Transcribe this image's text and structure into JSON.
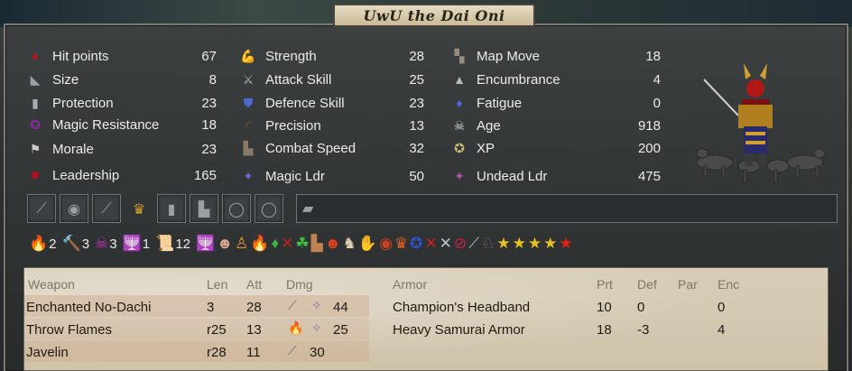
{
  "title": "UwU the Dai Oni",
  "stats": {
    "col1": [
      {
        "icon": "blood-drop-icon",
        "glyph": "♦",
        "color": "#c0101a",
        "label": "Hit points",
        "value": "67"
      },
      {
        "icon": "size-icon",
        "glyph": "◣",
        "color": "#9aa0a4",
        "label": "Size",
        "value": "8"
      },
      {
        "icon": "armor-icon",
        "glyph": "▮",
        "color": "#a9adb0",
        "label": "Protection",
        "value": "23"
      },
      {
        "icon": "pentagram-icon",
        "glyph": "✪",
        "color": "#8a2aa0",
        "label": "Magic Resistance",
        "value": "18"
      },
      {
        "icon": "flag-icon",
        "glyph": "⚑",
        "color": "#c9c9c9",
        "label": "Morale",
        "value": "23"
      },
      {
        "icon": "leadership-star-icon",
        "glyph": "✸",
        "color": "#b0101a",
        "label": "Leadership",
        "value": "165"
      }
    ],
    "col2": [
      {
        "icon": "flexed-arm-icon",
        "glyph": "💪",
        "color": "#c87a3a",
        "label": "Strength",
        "value": "28"
      },
      {
        "icon": "sword-icon",
        "glyph": "⚔",
        "color": "#b5b8ba",
        "label": "Attack Skill",
        "value": "25"
      },
      {
        "icon": "shield-icon",
        "glyph": "⛊",
        "color": "#4a6ad0",
        "label": "Defence Skill",
        "value": "23"
      },
      {
        "icon": "bow-icon",
        "glyph": "◜",
        "color": "#8a5a30",
        "label": "Precision",
        "value": "13"
      },
      {
        "icon": "boots-icon",
        "glyph": "▙",
        "color": "#8a7a6a",
        "label": "Combat Speed",
        "value": "32"
      },
      {
        "icon": "magic-leader-icon",
        "glyph": "✦",
        "color": "#6a6ad8",
        "label": "Magic Ldr",
        "value": "50"
      }
    ],
    "col3": [
      {
        "icon": "map-boot-icon",
        "glyph": "▚",
        "color": "#9a8a7a",
        "label": "Map Move",
        "value": "18"
      },
      {
        "icon": "weight-icon",
        "glyph": "▲",
        "color": "#b8b8b8",
        "label": "Encumbrance",
        "value": "4"
      },
      {
        "icon": "fatigue-drop-icon",
        "glyph": "♦",
        "color": "#4a6ae0",
        "label": "Fatigue",
        "value": "0"
      },
      {
        "icon": "skull-icon",
        "glyph": "☠",
        "color": "#d8d8d8",
        "label": "Age",
        "value": "918"
      },
      {
        "icon": "xp-star-icon",
        "glyph": "✪",
        "color": "#c8c070",
        "label": "XP",
        "value": "200"
      },
      {
        "icon": "undead-leader-icon",
        "glyph": "✦",
        "color": "#b050b0",
        "label": "Undead Ldr",
        "value": "475"
      }
    ]
  },
  "slots": [
    {
      "icon": "weapon-slot-icon",
      "glyph": "⟋"
    },
    {
      "icon": "shield-slot-icon",
      "glyph": "◉"
    },
    {
      "icon": "bow-slot-icon",
      "glyph": "⟋"
    },
    {
      "icon": "crown-icon",
      "glyph": "♛"
    },
    {
      "icon": "body-armor-slot-icon",
      "glyph": "▮"
    },
    {
      "icon": "boots-slot-icon",
      "glyph": "▙"
    },
    {
      "icon": "ring-slot-icon",
      "glyph": "◯"
    },
    {
      "icon": "ring-slot-icon-2",
      "glyph": "◯"
    },
    {
      "icon": "misc-slot-icon",
      "glyph": "▰"
    }
  ],
  "effects": [
    {
      "icon": "fire-magic-icon",
      "glyph": "🔥",
      "color": "#f07020",
      "count": "2"
    },
    {
      "icon": "hammer-icon",
      "glyph": "🔨",
      "color": "#c08040",
      "count": "3"
    },
    {
      "icon": "death-magic-skull-icon",
      "glyph": "☠",
      "color": "#c030c0",
      "count": "3"
    },
    {
      "icon": "candelabra-icon",
      "glyph": "🕎",
      "color": "#e0c070",
      "count": "1"
    },
    {
      "icon": "scroll-icon",
      "glyph": "📜",
      "color": "#d0a060",
      "count": "12"
    },
    {
      "icon": "candelabra-icon-2",
      "glyph": "🕎",
      "color": "#e0c070",
      "count": ""
    },
    {
      "icon": "head-icon",
      "glyph": "☻",
      "color": "#d8a890",
      "count": ""
    },
    {
      "icon": "idol-icon",
      "glyph": "♙",
      "color": "#e09030",
      "count": ""
    },
    {
      "icon": "flame-icon",
      "glyph": "🔥",
      "color": "#f05010",
      "count": ""
    },
    {
      "icon": "poison-drop-icon",
      "glyph": "♦",
      "color": "#40b040",
      "count": ""
    },
    {
      "icon": "no-weapon-icon",
      "glyph": "✕",
      "color": "#c02020",
      "count": ""
    },
    {
      "icon": "clover-icon",
      "glyph": "☘",
      "color": "#40c040",
      "count": ""
    },
    {
      "icon": "boot-icon",
      "glyph": "▙",
      "color": "#c08050",
      "count": ""
    },
    {
      "icon": "demon-head-icon",
      "glyph": "☻",
      "color": "#e04020",
      "count": ""
    },
    {
      "icon": "goat-icon",
      "glyph": "♞",
      "color": "#e0d0b0",
      "count": ""
    },
    {
      "icon": "hand-icon",
      "glyph": "✋",
      "color": "#e08050",
      "count": ""
    },
    {
      "icon": "eye-icon",
      "glyph": "◉",
      "color": "#d04020",
      "count": ""
    },
    {
      "icon": "crown-fire-icon",
      "glyph": "♛",
      "color": "#e06020",
      "count": ""
    },
    {
      "icon": "blue-pentagram-icon",
      "glyph": "✪",
      "color": "#3050d0",
      "count": ""
    },
    {
      "icon": "crossed-swords-red-icon",
      "glyph": "✕",
      "color": "#d02020",
      "count": ""
    },
    {
      "icon": "crossed-swords-icon",
      "glyph": "✕",
      "color": "#c0c4c8",
      "count": ""
    },
    {
      "icon": "no-magic-icon",
      "glyph": "⊘",
      "color": "#d02040",
      "count": ""
    },
    {
      "icon": "sword-slash-icon",
      "glyph": "⟋",
      "color": "#c0c4c8",
      "count": ""
    },
    {
      "icon": "wolf-icon",
      "glyph": "♘",
      "color": "#8a6a7a",
      "count": ""
    },
    {
      "icon": "gold-star-icon-1",
      "glyph": "★",
      "color": "#e8c020",
      "count": ""
    },
    {
      "icon": "gold-star-icon-2",
      "glyph": "★",
      "color": "#e8c020",
      "count": ""
    },
    {
      "icon": "gold-star-icon-3",
      "glyph": "★",
      "color": "#e8c020",
      "count": ""
    },
    {
      "icon": "gold-star-icon-4",
      "glyph": "★",
      "color": "#e8c020",
      "count": ""
    },
    {
      "icon": "red-star-icon",
      "glyph": "★",
      "color": "#e02010",
      "count": ""
    }
  ],
  "weapons": {
    "headers": {
      "name": "Weapon",
      "len": "Len",
      "att": "Att",
      "dmg": "Dmg"
    },
    "rows": [
      {
        "name": "Enchanted No-Dachi",
        "len": "3",
        "att": "28",
        "dmg_icon": "sword-damage-icon",
        "dmg_glyph": "⟋",
        "dmg_icon2": "magic-sparkle-icon",
        "dmg_glyph2": "✧",
        "dmg": "44"
      },
      {
        "name": "Throw Flames",
        "len": "r25",
        "att": "13",
        "dmg_icon": "fire-damage-icon",
        "dmg_glyph": "🔥",
        "dmg_icon2": "magic-sparkle-icon",
        "dmg_glyph2": "✧",
        "dmg": "25"
      },
      {
        "name": "Javelin",
        "len": "r28",
        "att": "11",
        "dmg_icon": "javelin-icon",
        "dmg_glyph": "⟋",
        "dmg_icon2": "",
        "dmg_glyph2": "",
        "dmg": "30"
      }
    ]
  },
  "armor": {
    "headers": {
      "name": "Armor",
      "prt": "Prt",
      "def": "Def",
      "par": "Par",
      "enc": "Enc"
    },
    "rows": [
      {
        "name": "Champion's Headband",
        "prt": "10",
        "def": "0",
        "par": "",
        "enc": "0"
      },
      {
        "name": "Heavy Samurai Armor",
        "prt": "18",
        "def": "-3",
        "par": "",
        "enc": "4"
      }
    ]
  },
  "portrait": {
    "icon": "oni-samurai-portrait-icon"
  }
}
